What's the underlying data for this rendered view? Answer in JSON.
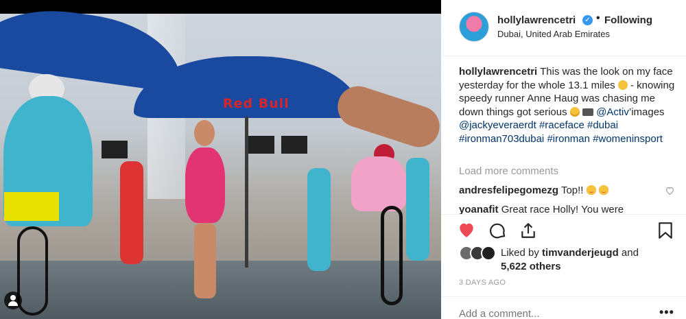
{
  "photo": {
    "alt_brand_mark": "Red Bull",
    "user_tag_icon": "user-tag-icon"
  },
  "header": {
    "username": "hollylawrencetri",
    "verified_icon": "verified-badge-icon",
    "separator": "•",
    "following": "Following",
    "location": "Dubai, United Arab Emirates"
  },
  "caption": {
    "user": "hollylawrencetri",
    "text_1": "This was the look on my face yesterday for the whole 13.1 miles",
    "text_2": "- knowing speedy runner Anne Haug was chasing me down things got serious",
    "mention_1": "@Activ",
    "text_3": "’images",
    "mention_2": "@jackyeveraerdt",
    "hashtags": [
      "#raceface",
      "#dubai",
      "#ironman703dubai",
      "#ironman",
      "#womeninsport"
    ]
  },
  "comments": {
    "load_more": "Load more comments",
    "items": [
      {
        "user": "andresfelipegomezg",
        "text": "Top!!"
      },
      {
        "user": "yoanafit",
        "text": "Great race Holly! You were"
      }
    ]
  },
  "actions": {
    "like_icon": "heart-filled-icon",
    "comment_icon": "comment-icon",
    "share_icon": "share-icon",
    "save_icon": "bookmark-icon",
    "like_color": "#ed4956"
  },
  "likes": {
    "prefix": "Liked by",
    "user": "timvanderjeugd",
    "and": "and",
    "others": "5,622 others"
  },
  "timestamp": "3 DAYS AGO",
  "add_comment": {
    "placeholder": "Add a comment...",
    "more_icon": "more-options-icon",
    "more_label": "•••"
  }
}
